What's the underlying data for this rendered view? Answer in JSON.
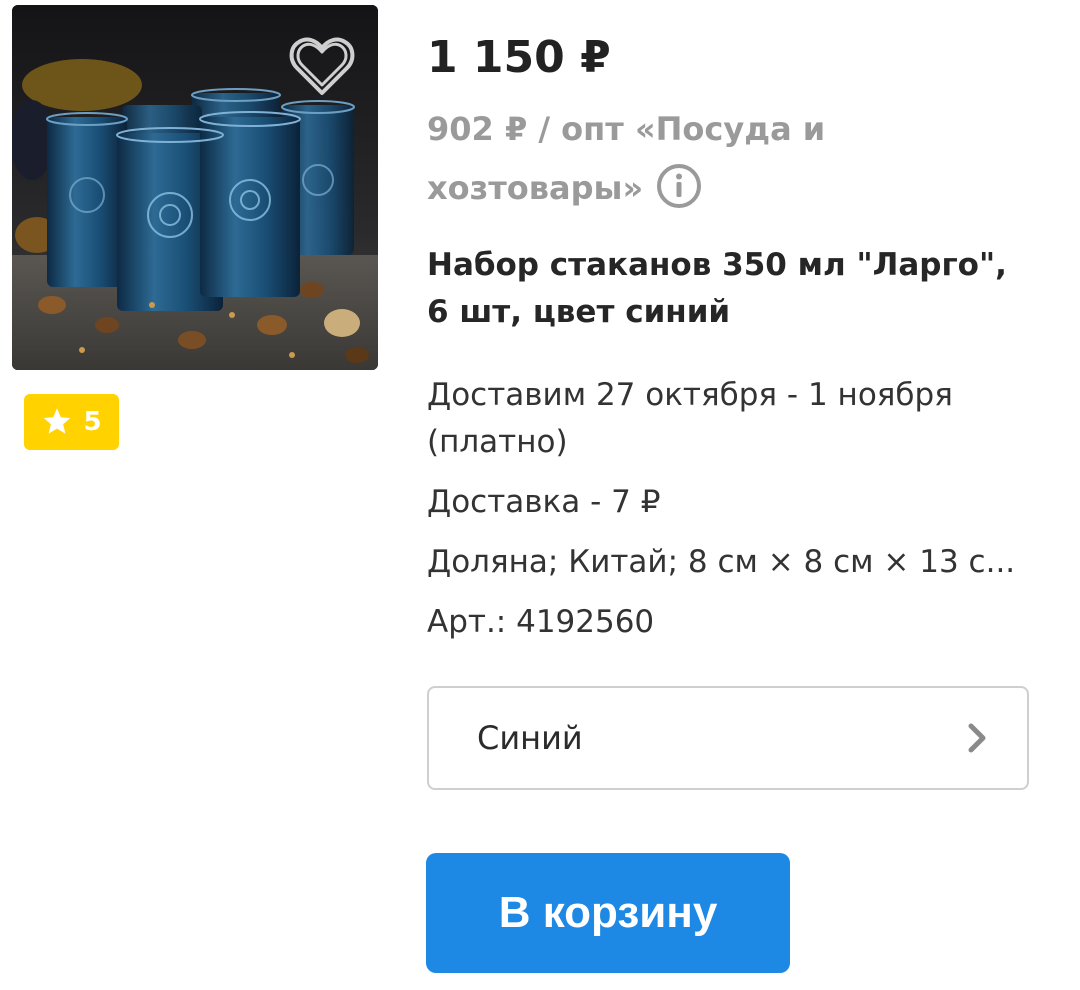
{
  "product": {
    "price": "1 150 ₽",
    "wholesale_text": "902 ₽ / опт «Посуда и хозтовары»",
    "title": "Набор стаканов 350 мл \"Ларго\", 6 шт, цвет синий",
    "rating": "5",
    "favorite": false
  },
  "details": {
    "delivery_dates": "Доставим 27 октября - 1 ноября (платно)",
    "delivery_cost": "Доставка - 7 ₽",
    "specs": "Доляна; Китай; 8 см × 8 см × 13 с...",
    "article": "Арт.: 4192560"
  },
  "variant": {
    "selected": "Синий"
  },
  "actions": {
    "add_to_cart": "В корзину"
  },
  "icons": {
    "favorite": "heart-icon",
    "info": "info-icon",
    "rating": "star-icon",
    "variant_chevron": "chevron-right-icon"
  },
  "colors": {
    "accent_button": "#1e88e5",
    "rating_badge": "#ffd200",
    "muted_text": "#9a9a9a",
    "border": "#cfcfcf"
  }
}
